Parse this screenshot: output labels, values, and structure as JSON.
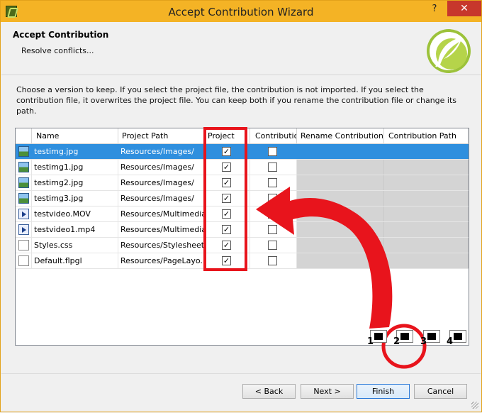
{
  "window": {
    "title": "Accept Contribution Wizard",
    "help": "?",
    "close": "✕"
  },
  "header": {
    "title": "Accept Contribution",
    "subtitle": "Resolve conflicts..."
  },
  "instructions": "Choose a version to keep. If you select the project file, the contribution is not imported. If you select the contribution file, it overwrites the project file. You can keep both if you rename the contribution file or change its path.",
  "table": {
    "columns": [
      "Name",
      "Project Path",
      "Project",
      "Contribution",
      "Rename Contribution",
      "Contribution Path"
    ],
    "rows": [
      {
        "name": "testimg.jpg",
        "path": "Resources/Images/",
        "icon": "image-file-icon",
        "project": true,
        "contribution": false
      },
      {
        "name": "testimg1.jpg",
        "path": "Resources/Images/",
        "icon": "image-file-icon",
        "project": true,
        "contribution": false
      },
      {
        "name": "testimg2.jpg",
        "path": "Resources/Images/",
        "icon": "image-file-icon",
        "project": true,
        "contribution": false
      },
      {
        "name": "testimg3.jpg",
        "path": "Resources/Images/",
        "icon": "image-file-icon",
        "project": true,
        "contribution": false
      },
      {
        "name": "testvideo.MOV",
        "path": "Resources/Multimedia/",
        "icon": "video-file-icon",
        "project": true,
        "contribution": false
      },
      {
        "name": "testvideo1.mp4",
        "path": "Resources/Multimedia/",
        "icon": "video-file-icon",
        "project": true,
        "contribution": false
      },
      {
        "name": "Styles.css",
        "path": "Resources/Stylesheets/",
        "icon": "document-file-icon",
        "project": true,
        "contribution": false
      },
      {
        "name": "Default.flpgl",
        "path": "Resources/PageLayo...",
        "icon": "document-file-icon",
        "project": true,
        "contribution": false
      }
    ]
  },
  "pager": [
    "1",
    "2",
    "3",
    "4"
  ],
  "buttons": {
    "back": "< Back",
    "next": "Next >",
    "finish": "Finish",
    "cancel": "Cancel"
  },
  "colors": {
    "titlebar": "#f4b325",
    "selection": "#2f8fde",
    "annotation": "#e8141c"
  }
}
